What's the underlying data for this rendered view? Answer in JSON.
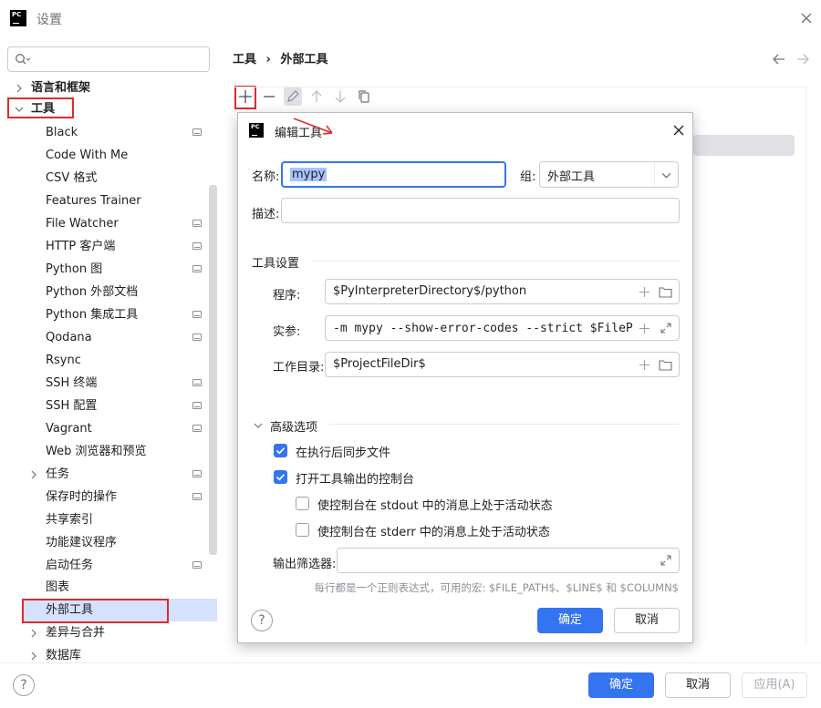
{
  "window": {
    "title": "设置",
    "logo_text": "PC"
  },
  "sidebar": {
    "search": {
      "placeholder": ""
    },
    "items": [
      {
        "label": "语言和框架"
      },
      {
        "label": "工具"
      },
      {
        "label": "Black"
      },
      {
        "label": "Code With Me"
      },
      {
        "label": "CSV 格式"
      },
      {
        "label": "Features Trainer"
      },
      {
        "label": "File Watcher"
      },
      {
        "label": "HTTP 客户端"
      },
      {
        "label": "Python 图"
      },
      {
        "label": "Python 外部文档"
      },
      {
        "label": "Python 集成工具"
      },
      {
        "label": "Qodana"
      },
      {
        "label": "Rsync"
      },
      {
        "label": "SSH 终端"
      },
      {
        "label": "SSH 配置"
      },
      {
        "label": "Vagrant"
      },
      {
        "label": "Web 浏览器和预览"
      },
      {
        "label": "任务"
      },
      {
        "label": "保存时的操作"
      },
      {
        "label": "共享索引"
      },
      {
        "label": "功能建议程序"
      },
      {
        "label": "启动任务"
      },
      {
        "label": "图表"
      },
      {
        "label": "外部工具"
      },
      {
        "label": "差异与合并"
      },
      {
        "label": "数据库"
      }
    ]
  },
  "breadcrumb": {
    "parent": "工具",
    "separator": "›",
    "current": "外部工具"
  },
  "dialog": {
    "logo_text": "PC",
    "title": "编辑工具",
    "name_label": "名称:",
    "name_value": "mypy",
    "group_label": "组:",
    "group_value": "外部工具",
    "desc_label": "描述:",
    "desc_value": "",
    "tool_settings_title": "工具设置",
    "program_label": "程序:",
    "program_value": "$PyInterpreterDirectory$/python",
    "args_label": "实参:",
    "args_value": "-m mypy --show-error-codes --strict $FilePath$",
    "workdir_label": "工作目录:",
    "workdir_value": "$ProjectFileDir$",
    "advanced_title": "高级选项",
    "sync_label": "在执行后同步文件",
    "sync_checked": true,
    "console_label": "打开工具输出的控制台",
    "console_checked": true,
    "stdout_label": "使控制台在 stdout 中的消息上处于活动状态",
    "stdout_checked": false,
    "stderr_label": "使控制台在 stderr 中的消息上处于活动状态",
    "stderr_checked": false,
    "filter_label": "输出筛选器:",
    "filter_value": "",
    "filter_hint": "每行都是一个正则表达式，可用的宏: $FILE_PATH$、$LINE$ 和 $COLUMN$",
    "help_glyph": "?",
    "ok_label": "确定",
    "cancel_label": "取消"
  },
  "footer": {
    "help_glyph": "?",
    "ok_label": "确定",
    "cancel_label": "取消",
    "apply_label": "应用(A)"
  },
  "colors": {
    "accent": "#3574f0",
    "selection": "#d5e1ff",
    "highlight_box": "#e02b2b"
  }
}
